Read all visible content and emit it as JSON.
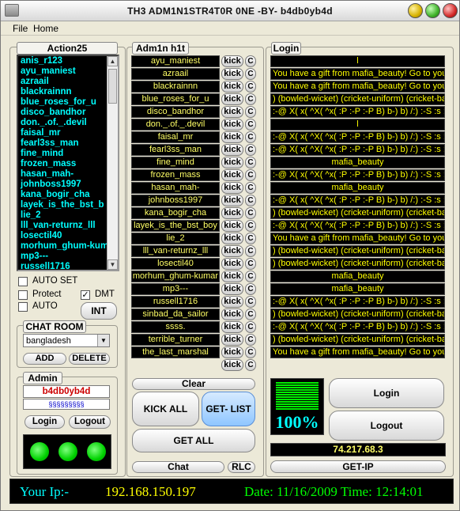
{
  "window": {
    "title": "TH3 ADM1N1STR4T0R 0NE -BY- b4db0yb4d"
  },
  "menu": [
    "File",
    "Home"
  ],
  "left": {
    "header": "Action25",
    "users": [
      "anis_r123",
      "ayu_maniest",
      "azraail",
      "blackrainnn",
      "blue_roses_for_u",
      "disco_bandhor",
      "don._.of._.devil",
      "faisal_mr",
      "fearl3ss_man",
      "fine_mind",
      "frozen_mass",
      "hasan_mah-",
      "johnboss1997",
      "kana_bogir_cha",
      "layek_is_the_bst_b",
      "lie_2",
      "lll_van-returnz_lll",
      "losectil40",
      "morhum_ghum-kuma",
      "mp3---",
      "russell1716"
    ],
    "auto_set": "AUTO SET",
    "protect": "Protect",
    "auto": "AUTO",
    "dmt": "DMT",
    "int": "INT",
    "chat_room_header": "CHAT ROOM",
    "chat_room_value": "bangladesh",
    "add": "ADD",
    "delete": "DELETE",
    "admin_header": "Admin",
    "admin_name": "b4db0yb4d",
    "admin_pass": "§§§§§§§§§",
    "login": "Login",
    "logout": "Logout"
  },
  "middle": {
    "header": "Adm1n h1t",
    "kick_label": "kick",
    "c_label": "C",
    "names": [
      "ayu_maniest",
      "azraail",
      "blackrainnn",
      "blue_roses_for_u",
      "disco_bandhor",
      "don._.of._.devil",
      "faisal_mr",
      "fearl3ss_man",
      "fine_mind",
      "frozen_mass",
      "hasan_mah-",
      "johnboss1997",
      "kana_bogir_cha",
      "layek_is_the_bst_boy",
      "lie_2",
      "lll_van-returnz_lll",
      "losectil40",
      "morhum_ghum-kumar",
      "mp3---",
      "russell1716",
      "sinbad_da_sailor",
      "ssss.",
      "terrible_turner",
      "the_last_marshal",
      ""
    ],
    "clear": "Clear",
    "kick_all": "KICK ALL",
    "get_list": "GET- LIST",
    "get_all": "GET ALL",
    "chat": "Chat",
    "rlc": "RLC"
  },
  "right": {
    "header": "Login",
    "logs": [
      "l",
      "You have a gift from mafia_beauty! Go to your",
      "You have a gift from mafia_beauty! Go to your",
      ") (bowled-wicket) (cricket-uniform) (cricket-ball",
      ":-@ X( x( ^X( ^x( :P :-P :-P B) b-) b) /:) :-S :s :-s",
      "l",
      ":-@ X( x( ^X( ^x( :P :-P :-P B) b-) b) /:) :-S :s :-s",
      ":-@ X( x( ^X( ^x( :P :-P :-P B) b-) b) /:) :-S :s :-s",
      "mafia_beauty",
      ":-@ X( x( ^X( ^x( :P :-P :-P B) b-) b) /:) :-S :s :-s",
      "mafia_beauty",
      ":-@ X( x( ^X( ^x( :P :-P :-P B) b-) b) /:) :-S :s :-s",
      ") (bowled-wicket) (cricket-uniform) (cricket-ball",
      ":-@ X( x( ^X( ^x( :P :-P :-P B) b-) b) /:) :-S :s :-s",
      "You have a gift from mafia_beauty! Go to your",
      ") (bowled-wicket) (cricket-uniform) (cricket-ball",
      ") (bowled-wicket) (cricket-uniform) (cricket-ball",
      "mafia_beauty",
      "mafia_beauty",
      ":-@ X( x( ^X( ^x( :P :-P :-P B) b-) b) /:) :-S :s :-s",
      ") (bowled-wicket) (cricket-uniform) (cricket-ball",
      ":-@ X( x( ^X( ^x( :P :-P :-P B) b-) b) /:) :-S :s :-s",
      ") (bowled-wicket) (cricket-uniform) (cricket-ball",
      "You have a gift from mafia_beauty! Go to your"
    ],
    "progress_label": "100%",
    "progress_value": 100,
    "login": "Login",
    "logout": "Logout",
    "ip": "74.217.68.3",
    "get_ip": "GET-IP"
  },
  "status": {
    "your_ip_label": "Your Ip:-",
    "your_ip": "192.168.150.197",
    "date_time": "Date: 11/16/2009 Time: 12:14:01"
  },
  "colors": {
    "list_text": "#00ffff",
    "name_text": "#ffff66",
    "log_text": "#ffff00",
    "status_ip_label": "#00ffff",
    "status_ip": "#ffff00",
    "status_date": "#00ff00",
    "progress_green": "#00ee00",
    "admin_name": "#cc0000"
  }
}
